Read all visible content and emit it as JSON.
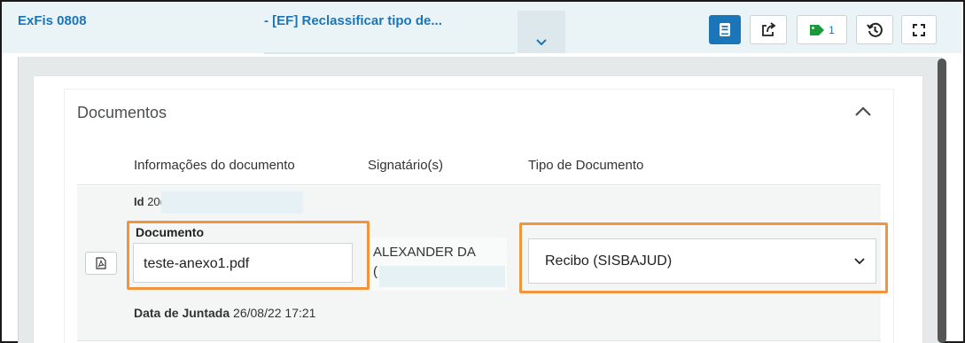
{
  "header": {
    "process_number": "ExFis 0808",
    "task_title": "- [EF] Reclassificar tipo de...",
    "tag_count": "1"
  },
  "toolbar": {
    "icons": [
      "book-icon",
      "share-icon",
      "tag-icon",
      "history-icon",
      "fullscreen-icon"
    ],
    "active_color": "#1a76b8",
    "tag_color": "#1a9a3a"
  },
  "section": {
    "title": "Documentos",
    "columns": [
      "Informações do documento",
      "Signatário(s)",
      "Tipo de Documento"
    ]
  },
  "document_row": {
    "id_label": "Id",
    "id_value": "20(",
    "document_label": "Documento",
    "document_value": "teste-anexo1.pdf",
    "signer": "ALEXANDER DA",
    "signer_line2": "(",
    "document_type": "Recibo (SISBAJUD)",
    "date_label": "Data de Juntada",
    "date_value": "26/08/22 17:21"
  },
  "colors": {
    "accent": "#1a76b8",
    "highlight": "#f0953b"
  }
}
